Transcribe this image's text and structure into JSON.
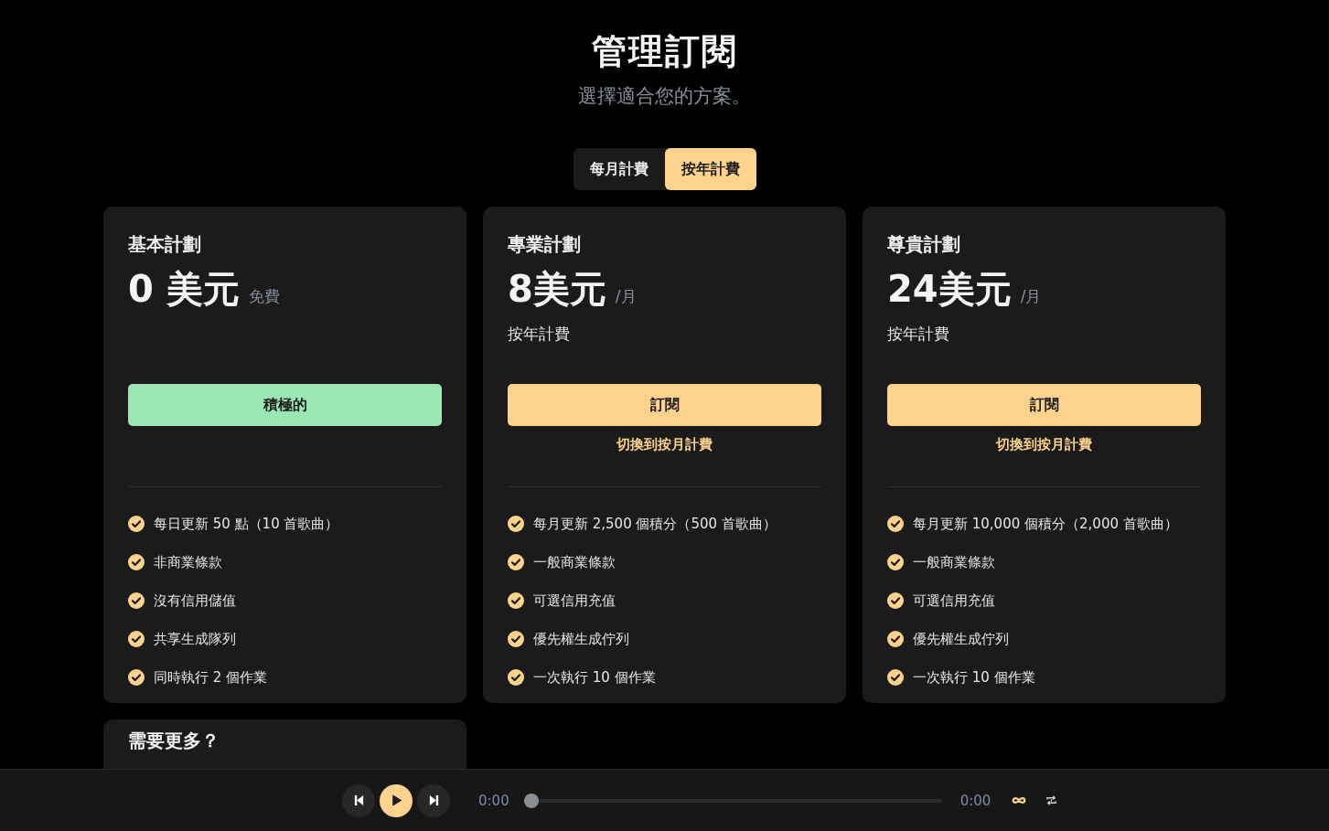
{
  "header": {
    "title": "管理訂閱",
    "subtitle": "選擇適合您的方案。"
  },
  "billing_tabs": [
    {
      "label": "每月計費",
      "selected": false
    },
    {
      "label": "按年計費",
      "selected": true
    }
  ],
  "plans": [
    {
      "name": "基本計劃",
      "price": "0 美元",
      "price_suffix": "免費",
      "button": {
        "kind": "active",
        "label": "積極的"
      },
      "features": [
        "每日更新 50 點（10 首歌曲）",
        "非商業條款",
        "沒有信用儲值",
        "共享生成隊列",
        "同時執行 2 個作業"
      ]
    },
    {
      "name": "專業計劃",
      "price": "8美元",
      "price_suffix": "/月",
      "billing_note": "按年計費",
      "button": {
        "kind": "subscribe",
        "label": "訂閱"
      },
      "switch_link": "切換到按月計費",
      "features": [
        "每月更新 2,500 個積分（500 首歌曲）",
        "一般商業條款",
        "可選信用充值",
        "優先權生成佇列",
        "一次執行 10 個作業"
      ]
    },
    {
      "name": "尊貴計劃",
      "price": "24美元",
      "price_suffix": "/月",
      "billing_note": "按年計費",
      "button": {
        "kind": "subscribe",
        "label": "訂閱"
      },
      "switch_link": "切換到按月計費",
      "features": [
        "每月更新 10,000 個積分（2,000 首歌曲）",
        "一般商業條款",
        "可選信用充值",
        "優先權生成佇列",
        "一次執行 10 個作業"
      ]
    }
  ],
  "more_card": {
    "title": "需要更多？"
  },
  "player": {
    "elapsed": "0:00",
    "duration": "0:00",
    "level": 0
  }
}
